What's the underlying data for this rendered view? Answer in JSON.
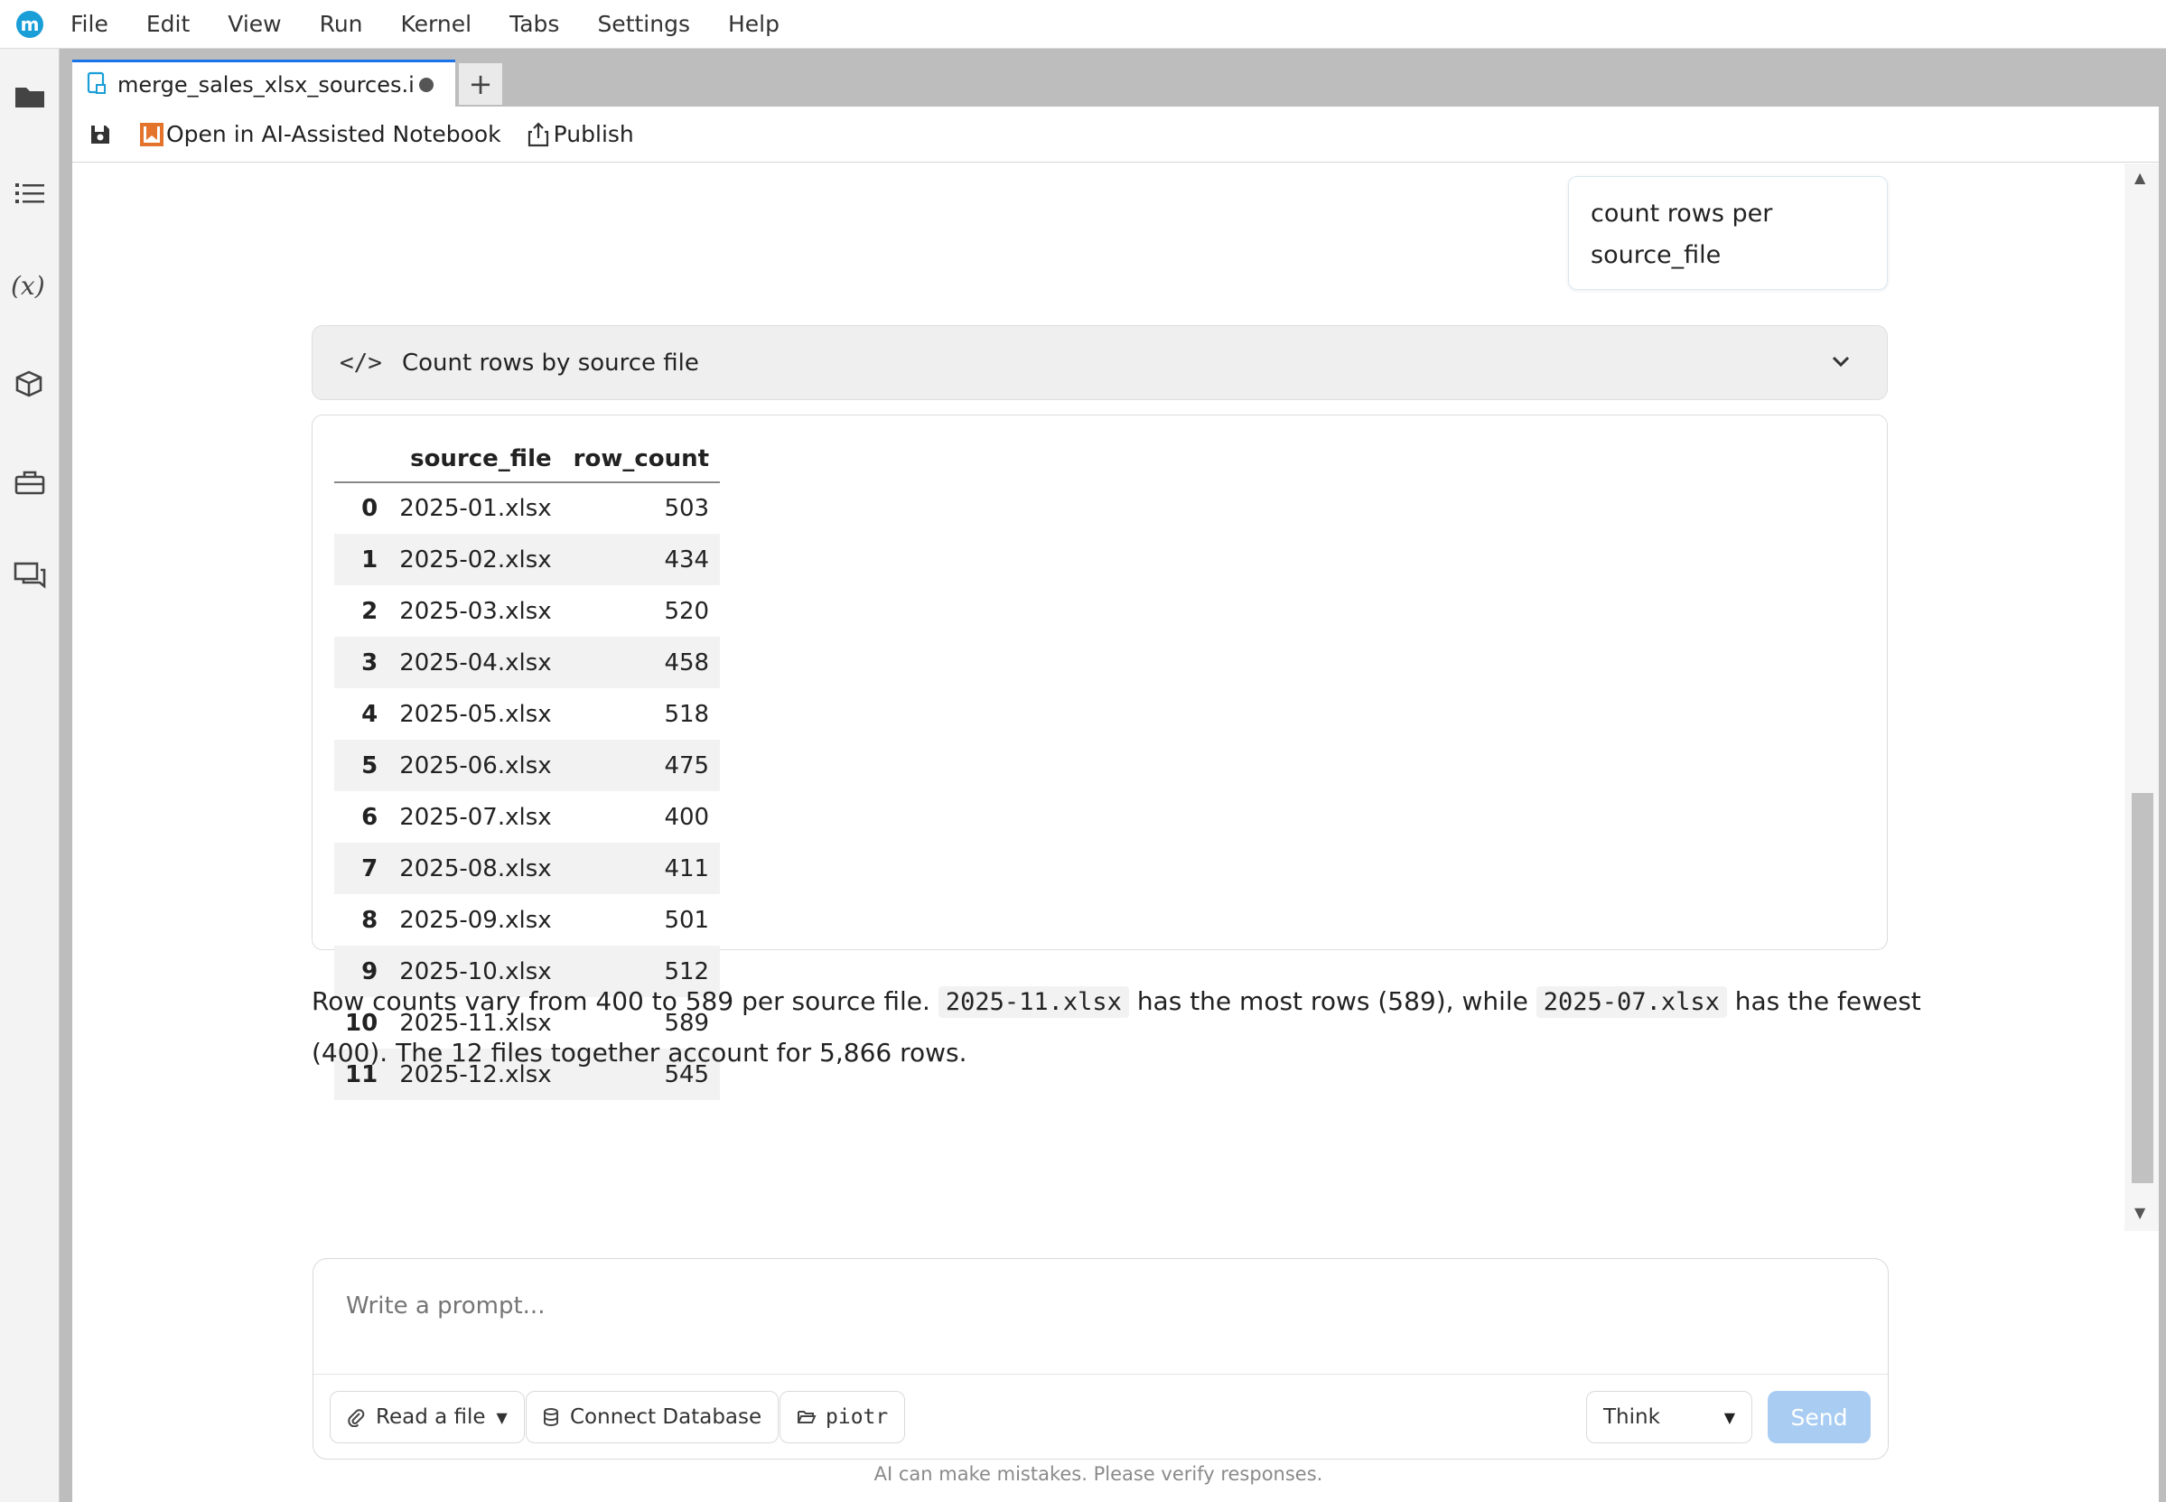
{
  "menubar": {
    "logo_letter": "m",
    "items": [
      "File",
      "Edit",
      "View",
      "Run",
      "Kernel",
      "Tabs",
      "Settings",
      "Help"
    ]
  },
  "tabs": {
    "active_label": "merge_sales_xlsx_sources.ip",
    "add_label": "+"
  },
  "toolbar": {
    "open_ai_label": "Open in AI-Assisted Notebook",
    "publish_label": "Publish"
  },
  "chat": {
    "user_message": "count rows per source_file",
    "code_block_title": "Count rows by source file",
    "code_glyph": "</>",
    "table": {
      "columns": [
        "source_file",
        "row_count"
      ],
      "rows": [
        {
          "index": "0",
          "source_file": "2025-01.xlsx",
          "row_count": "503"
        },
        {
          "index": "1",
          "source_file": "2025-02.xlsx",
          "row_count": "434"
        },
        {
          "index": "2",
          "source_file": "2025-03.xlsx",
          "row_count": "520"
        },
        {
          "index": "3",
          "source_file": "2025-04.xlsx",
          "row_count": "458"
        },
        {
          "index": "4",
          "source_file": "2025-05.xlsx",
          "row_count": "518"
        },
        {
          "index": "5",
          "source_file": "2025-06.xlsx",
          "row_count": "475"
        },
        {
          "index": "6",
          "source_file": "2025-07.xlsx",
          "row_count": "400"
        },
        {
          "index": "7",
          "source_file": "2025-08.xlsx",
          "row_count": "411"
        },
        {
          "index": "8",
          "source_file": "2025-09.xlsx",
          "row_count": "501"
        },
        {
          "index": "9",
          "source_file": "2025-10.xlsx",
          "row_count": "512"
        },
        {
          "index": "10",
          "source_file": "2025-11.xlsx",
          "row_count": "589"
        },
        {
          "index": "11",
          "source_file": "2025-12.xlsx",
          "row_count": "545"
        }
      ]
    },
    "answer": {
      "part1": "Row counts vary from 400 to 589 per source file.",
      "code1": "2025-11.xlsx",
      "part2": "has the most rows (589), while",
      "code2": "2025-07.xlsx",
      "part3": "has the fewest (400). The 12 files together account for 5,866 rows."
    }
  },
  "prompt": {
    "placeholder": "Write a prompt...",
    "read_file_label": "Read a file",
    "connect_db_label": "Connect Database",
    "folder_label": "piotr",
    "mode_value": "Think",
    "send_label": "Send",
    "disclaimer": "AI can make mistakes. Please verify responses."
  },
  "colors": {
    "accent": "#1a9ed8",
    "send_disabled": "#a9cdf2",
    "tab_active_border": "#1a73e8"
  }
}
